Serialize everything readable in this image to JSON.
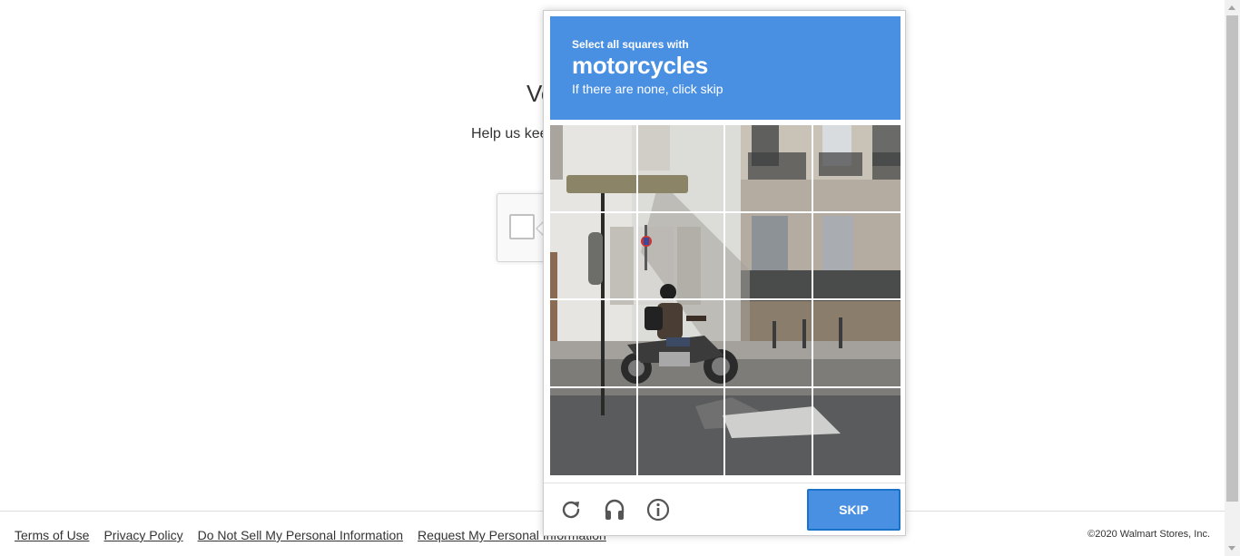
{
  "page": {
    "title_partial": "Ve",
    "help_text_partial": "Help us kee"
  },
  "challenge": {
    "instruction": "Select all squares with",
    "object": "motorcycles",
    "skip_hint": "If there are none, click skip",
    "skip_label": "SKIP",
    "header_color": "#4a90e2",
    "grid": {
      "rows": 4,
      "cols": 4
    },
    "footer_icons": [
      "reload-icon",
      "audio-headphones-icon",
      "info-icon"
    ]
  },
  "footer": {
    "links": [
      "Terms of Use",
      "Privacy Policy",
      "Do Not Sell My Personal Information",
      "Request My Personal Information"
    ],
    "copyright": "©2020 Walmart Stores, Inc."
  }
}
